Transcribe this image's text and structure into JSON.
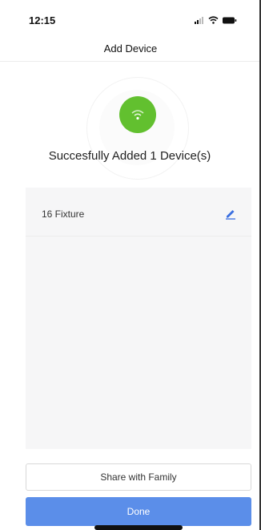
{
  "status_bar": {
    "time": "12:15"
  },
  "header": {
    "title": "Add Device"
  },
  "result": {
    "message": "Succesfully Added 1 Device(s)"
  },
  "devices": [
    {
      "name": "16 Fixture"
    }
  ],
  "actions": {
    "share_label": "Share with Family",
    "done_label": "Done"
  },
  "colors": {
    "success": "#62c02f",
    "primary": "#5b8ee9",
    "edit_icon": "#3b6fe0"
  },
  "icons": {
    "success": "wifi-icon",
    "edit": "pencil-icon"
  }
}
